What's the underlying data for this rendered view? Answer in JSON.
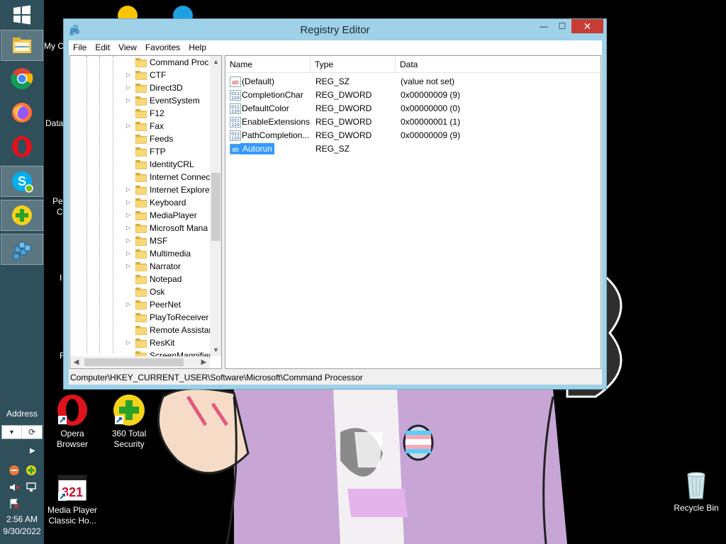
{
  "taskbar": {
    "address_label": "Address",
    "clock_time": "2:56 AM",
    "clock_date": "9/30/2022",
    "pinned": [
      {
        "name": "start-button",
        "icon": "windows-logo-icon"
      },
      {
        "name": "file-explorer",
        "icon": "folder-icon"
      },
      {
        "name": "chrome",
        "icon": "chrome-icon"
      },
      {
        "name": "firefox",
        "icon": "firefox-icon"
      },
      {
        "name": "opera",
        "icon": "opera-icon"
      },
      {
        "name": "skype",
        "icon": "skype-icon"
      },
      {
        "name": "360-total-security",
        "icon": "360-security-icon"
      },
      {
        "name": "registry-editor",
        "icon": "regedit-icon"
      }
    ]
  },
  "desktop": {
    "icons": [
      {
        "label": "Opera Browser",
        "line1": "Opera",
        "line2": "Browser"
      },
      {
        "label": "360 Total Security",
        "line1": "360 Total",
        "line2": "Security"
      },
      {
        "label": "Media Player Classic Ho...",
        "line1": "Media Player",
        "line2": "Classic Ho..."
      },
      {
        "label": "Recycle Bin",
        "line1": "Recycle Bin",
        "line2": ""
      }
    ],
    "partial_labels": [
      "My C",
      "Data",
      "Pe",
      "C",
      "I",
      "F"
    ]
  },
  "window": {
    "title": "Registry Editor",
    "controls": {
      "minimize": "—",
      "maximize": "☐",
      "close": "✕"
    },
    "menu": [
      "File",
      "Edit",
      "View",
      "Favorites",
      "Help"
    ],
    "tree": {
      "items": [
        {
          "label": "Command Proc",
          "expandable": false,
          "selected": false
        },
        {
          "label": "CTF",
          "expandable": true
        },
        {
          "label": "Direct3D",
          "expandable": true
        },
        {
          "label": "EventSystem",
          "expandable": true
        },
        {
          "label": "F12",
          "expandable": false
        },
        {
          "label": "Fax",
          "expandable": true
        },
        {
          "label": "Feeds",
          "expandable": false
        },
        {
          "label": "FTP",
          "expandable": false
        },
        {
          "label": "IdentityCRL",
          "expandable": false
        },
        {
          "label": "Internet Connec",
          "expandable": false
        },
        {
          "label": "Internet Explorer",
          "expandable": true
        },
        {
          "label": "Keyboard",
          "expandable": true
        },
        {
          "label": "MediaPlayer",
          "expandable": true
        },
        {
          "label": "Microsoft Mana",
          "expandable": true
        },
        {
          "label": "MSF",
          "expandable": true
        },
        {
          "label": "Multimedia",
          "expandable": true
        },
        {
          "label": "Narrator",
          "expandable": true
        },
        {
          "label": "Notepad",
          "expandable": false
        },
        {
          "label": "Osk",
          "expandable": false
        },
        {
          "label": "PeerNet",
          "expandable": true
        },
        {
          "label": "PlayToReceiver",
          "expandable": false
        },
        {
          "label": "Remote Assistar",
          "expandable": false
        },
        {
          "label": "ResKit",
          "expandable": true
        },
        {
          "label": "ScreenMagnifier",
          "expandable": false
        }
      ]
    },
    "columns": {
      "name": "Name",
      "type": "Type",
      "data": "Data"
    },
    "values": [
      {
        "name": "(Default)",
        "type": "REG_SZ",
        "data": "(value not set)",
        "icon": "string-value-icon"
      },
      {
        "name": "CompletionChar",
        "type": "REG_DWORD",
        "data": "0x00000009 (9)",
        "icon": "binary-value-icon"
      },
      {
        "name": "DefaultColor",
        "type": "REG_DWORD",
        "data": "0x00000000 (0)",
        "icon": "binary-value-icon"
      },
      {
        "name": "EnableExtensions",
        "type": "REG_DWORD",
        "data": "0x00000001 (1)",
        "icon": "binary-value-icon"
      },
      {
        "name": "PathCompletion...",
        "type": "REG_DWORD",
        "data": "0x00000009 (9)",
        "icon": "binary-value-icon"
      },
      {
        "name": "Autorun",
        "type": "REG_SZ",
        "data": "",
        "icon": "string-value-icon",
        "selected": true
      }
    ],
    "status": "Computer\\HKEY_CURRENT_USER\\Software\\Microsoft\\Command Processor"
  }
}
